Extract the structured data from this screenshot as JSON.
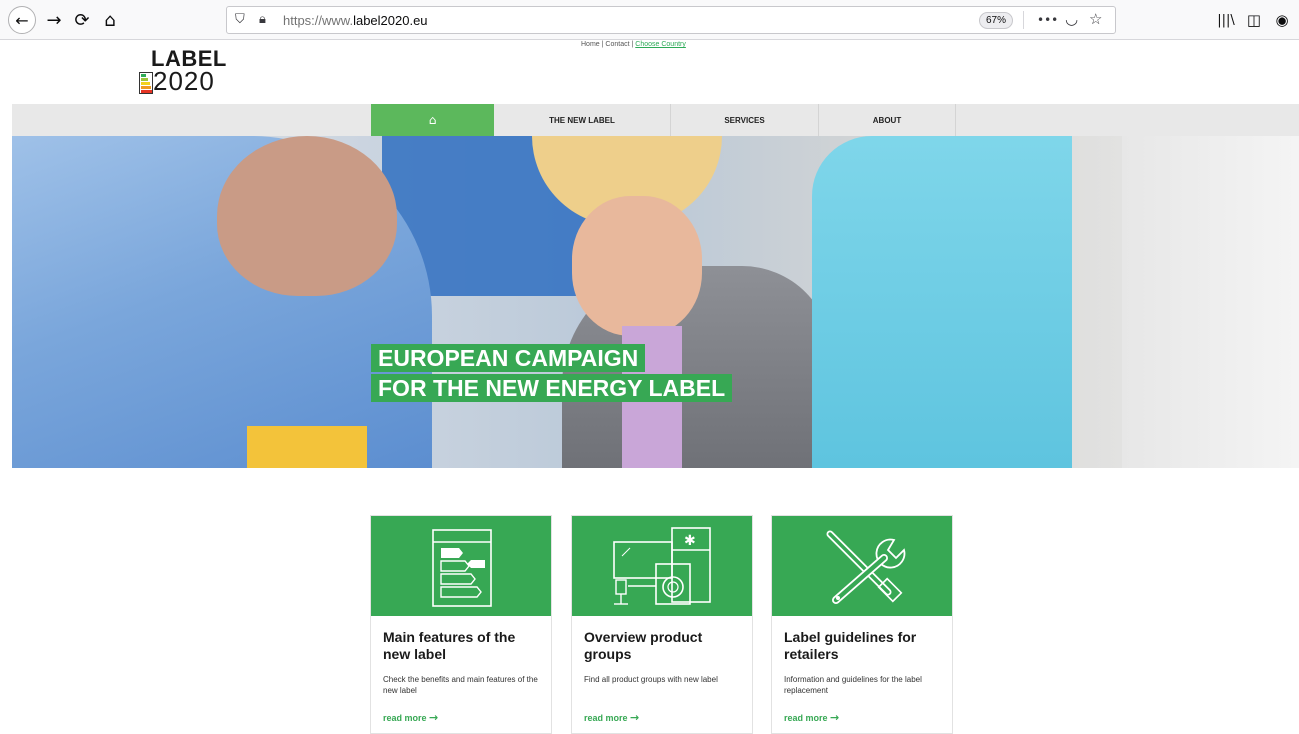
{
  "browser": {
    "url_prefix": "https://www.",
    "url_domain": "label2020.eu",
    "zoom": "67%",
    "back_icon": "←",
    "forward_icon": "→",
    "reload_icon": "⟳",
    "home_icon": "⌂",
    "more_icon": "•••",
    "pocket_icon": "◡",
    "star_icon": "☆",
    "library_icon": "|||\\",
    "sidebar_icon": "◫",
    "account_icon": "◉"
  },
  "logo": {
    "word": "LABEL",
    "year": "2020"
  },
  "topnav": {
    "home": "Home",
    "sep1": "|",
    "contact": "Contact",
    "sep2": "|",
    "country": "Choose Country"
  },
  "mainnav": {
    "home_icon": "⌂",
    "items": [
      "THE NEW LABEL",
      "SERVICES",
      "ABOUT"
    ]
  },
  "hero": {
    "line1": "EUROPEAN CAMPAIGN",
    "line2": "FOR THE NEW ENERGY LABEL"
  },
  "cards": [
    {
      "title": "Main features of the new label",
      "desc": "Check the benefits and main features of the new label",
      "link": "read more",
      "arrow": "→",
      "icon": "energy-label-icon"
    },
    {
      "title": "Overview product groups",
      "desc": "Find all product groups with new label",
      "link": "read more",
      "arrow": "→",
      "icon": "appliances-icon"
    },
    {
      "title": "Label guidelines for retailers",
      "desc": "Information and guidelines for the label replacement",
      "link": "read more",
      "arrow": "→",
      "icon": "tools-icon"
    }
  ],
  "colors": {
    "brand_green": "#37a854",
    "nav_bg": "#e8e8e8"
  }
}
